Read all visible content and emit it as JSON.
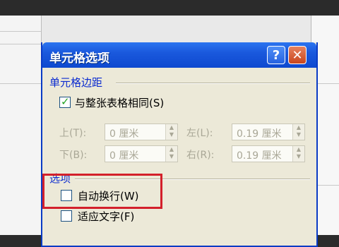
{
  "dialog": {
    "title": "单元格选项",
    "help_label": "?",
    "close_label": "✕",
    "margins_section": {
      "label": "单元格边距",
      "same_as_table": {
        "label": "与整张表格相同(S)",
        "checked": true
      },
      "fields": {
        "top": {
          "label": "上(T):",
          "value": "0 厘米"
        },
        "left": {
          "label": "左(L):",
          "value": "0.19 厘米"
        },
        "bottom": {
          "label": "下(B):",
          "value": "0 厘米"
        },
        "right": {
          "label": "右(R):",
          "value": "0.19 厘米"
        }
      }
    },
    "options_section": {
      "label": "选项",
      "wrap_text": {
        "label": "自动换行(W)",
        "checked": false
      },
      "fit_text": {
        "label": "适应文字(F)",
        "checked": false
      }
    }
  },
  "colors": {
    "titlebar": "#1a59dd",
    "highlight": "#d3202b",
    "section_label": "#0b2bd0"
  }
}
